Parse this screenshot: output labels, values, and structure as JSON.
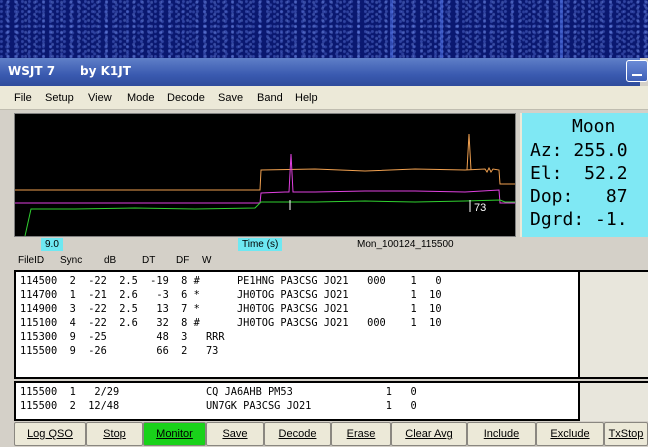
{
  "window": {
    "title": "WSJT 7",
    "author": "by K1JT"
  },
  "menu": [
    "File",
    "Setup",
    "View",
    "Mode",
    "Decode",
    "Save",
    "Band",
    "Help"
  ],
  "moon": {
    "title": "Moon",
    "rows": [
      "Az: 255.0",
      "El:  52.2",
      "Dop:   87",
      "Dgrd: -1."
    ]
  },
  "scale": {
    "left_value": "9.0",
    "axis_label": "Time (s)",
    "file_name": "Mon_100124_115500",
    "marker": "73"
  },
  "columns": [
    "FileID",
    "Sync",
    "dB",
    "DT",
    "DF",
    "W"
  ],
  "decoded": [
    "114500  2  -22  2.5  -19  8 #      PE1HNG PA3CSG JO21   000    1   0",
    "114700  1  -21  2.6   -3  6 *      JH0TOG PA3CSG JO21          1  10",
    "114900  3  -22  2.5   13  7 *      JH0TOG PA3CSG JO21          1  10",
    "115100  4  -22  2.6   32  8 #      JH0TOG PA3CSG JO21   000    1  10",
    "115300  9  -25        48  3   RRR",
    "115500  9  -26        66  2   73"
  ],
  "average": [
    "115500  1   2/29              CQ JA6AHB PM53               1   0",
    "115500  2  12/48              UN7GK PA3CSG JO21            1   0"
  ],
  "buttons": [
    {
      "label": "Log QSO",
      "active": false
    },
    {
      "label": "Stop",
      "active": false
    },
    {
      "label": "Monitor",
      "active": true
    },
    {
      "label": "Save",
      "active": false
    },
    {
      "label": "Decode",
      "active": false
    },
    {
      "label": "Erase",
      "active": false
    },
    {
      "label": "Clear Avg",
      "active": false
    },
    {
      "label": "Include",
      "active": false
    },
    {
      "label": "Exclude",
      "active": false
    },
    {
      "label": "TxStop",
      "active": false
    }
  ],
  "colors": {
    "monitor_active": "#19d21a",
    "moon_panel": "#7fe8f4",
    "scale_tag": "#6ee8f2",
    "trace_orange": "#f0a050",
    "trace_magenta": "#e040e0",
    "trace_green": "#30d030"
  }
}
